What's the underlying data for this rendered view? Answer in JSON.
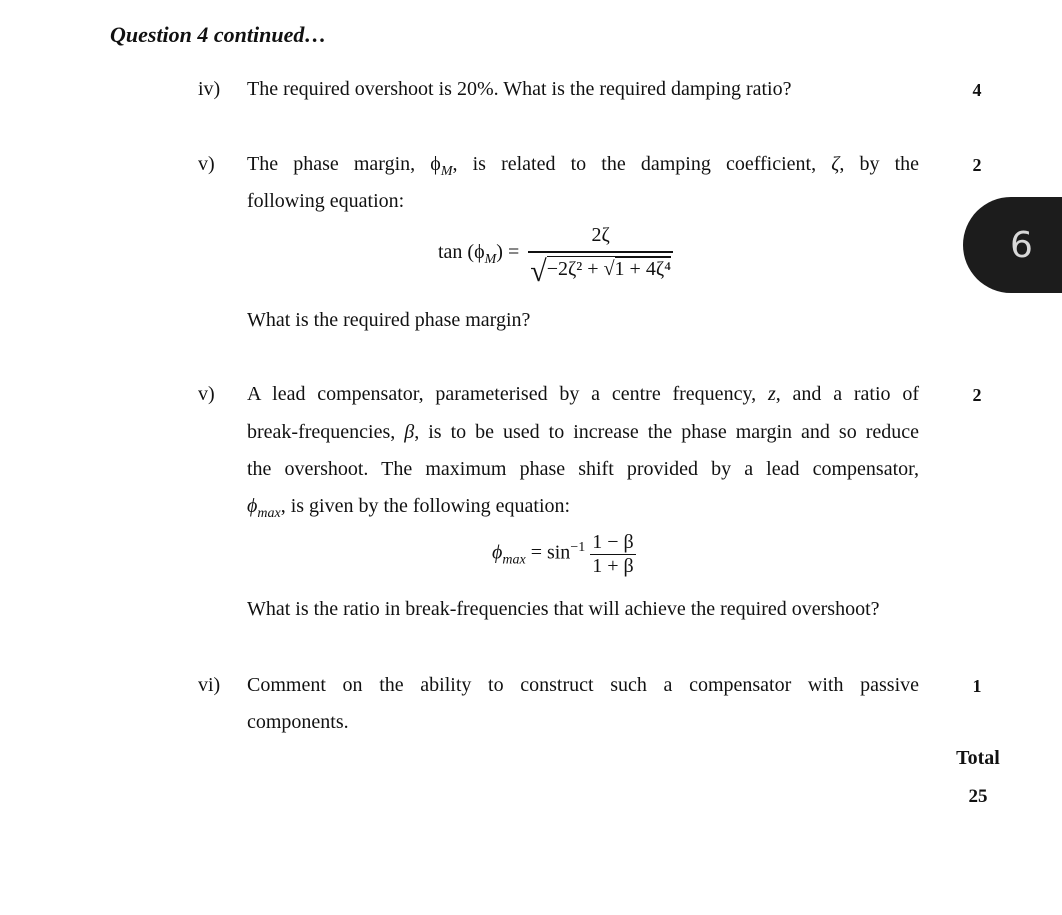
{
  "heading": "Question 4 continued…",
  "questions": [
    {
      "label": "iv)",
      "lines": [
        "The required overshoot is 20%. What is the required damping ratio?"
      ],
      "marks": "4"
    },
    {
      "label": "v)",
      "line1_parts": [
        "The phase margin, ",
        "ϕ",
        "M",
        ", is related to the damping coefficient, ",
        "ζ",
        ", by the"
      ],
      "line2": "following equation:",
      "equation": {
        "lhs": "tan (ϕ",
        "lhs_sub": "M",
        "lhs_close": ") =",
        "numerator": "2ζ",
        "denominator_a": "−2ζ² + ",
        "denominator_b": "1 + 4ζ⁴"
      },
      "question": "What is the required phase margin?",
      "marks": "2"
    },
    {
      "label": "v)",
      "line1": "A lead compensator, parameterised by a centre frequency, ",
      "line1_var": "z",
      "line1_end": ", and a ratio of",
      "line2a": "break-frequencies, ",
      "line2_var": "β",
      "line2b": ", is to be used to increase the phase margin and so reduce",
      "line3": "the overshoot. The maximum phase shift provided by a lead compensator,",
      "line4_var": "ϕ",
      "line4_sub": "max",
      "line4": ", is given by the following equation:",
      "equation": {
        "lhs": "ϕ",
        "lhs_sub": "max",
        "op": " = sin",
        "sup": "−1",
        "numerator": "1 − β",
        "denominator": "1 + β"
      },
      "question": "What is the ratio in break-frequencies that will achieve the required overshoot?",
      "marks": "2"
    },
    {
      "label": "vi)",
      "line1": "Comment on the ability to construct such a compensator with passive",
      "line2": "components.",
      "marks": "1"
    }
  ],
  "total": {
    "label": "Total",
    "value": "25"
  },
  "page_badge": "6"
}
